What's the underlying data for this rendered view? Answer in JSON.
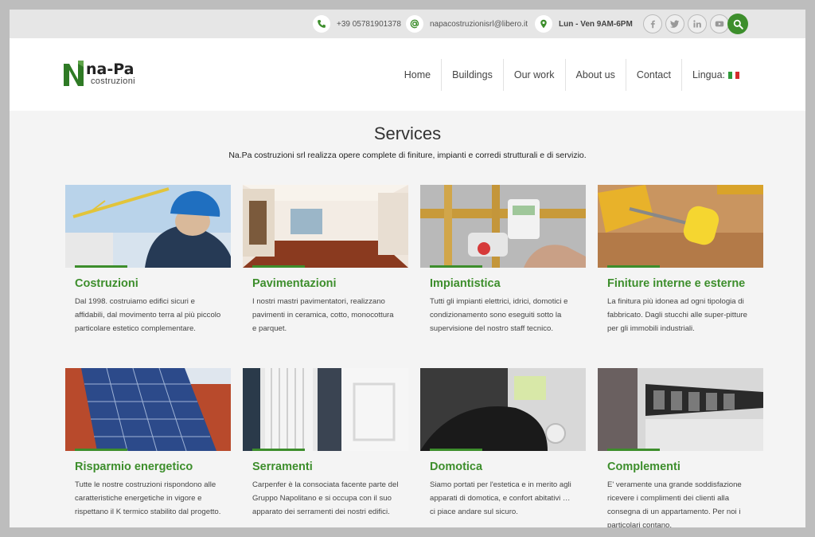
{
  "topbar": {
    "phone": "+39 05781901378",
    "email": "napacostruzionisrl@libero.it",
    "hours": "Lun - Ven 9AM-6PM",
    "social": [
      "facebook-icon",
      "twitter-icon",
      "linkedin-icon",
      "youtube-icon"
    ]
  },
  "header": {
    "logo_main": "na-Pa",
    "logo_sub": "costruzioni",
    "nav": [
      "Home",
      "Buildings",
      "Our work",
      "About us",
      "Contact",
      "Lingua:"
    ]
  },
  "services": {
    "title": "Services",
    "subtitle": "Na.Pa costruzioni srl realizza opere complete di finiture, impianti e corredi strutturali e di servizio.",
    "cards": [
      {
        "title": "Costruzioni",
        "text": "Dal 1998. costruiamo edifici sicuri e affidabili, dal movimento terra al più piccolo particolare estetico complementare."
      },
      {
        "title": "Pavimentazioni",
        "text": "I nostri mastri pavimentatori, realizzano pavimenti in ceramica, cotto, monocottura e parquet."
      },
      {
        "title": "Impiantistica",
        "text": "Tutti gli impianti elettrici, idrici, domotici e condizionamento sono eseguiti sotto la supervisione del nostro staff tecnico."
      },
      {
        "title": "Finiture interne e esterne",
        "text": "La finitura più idonea ad ogni tipologia di fabbricato. Dagli stucchi alle super-pitture per gli immobili industriali."
      },
      {
        "title": "Risparmio energetico",
        "text": "Tutte le nostre costruzioni rispondono alle caratteristiche energetiche in vigore e rispettano il K termico stabilito dal progetto."
      },
      {
        "title": "Serramenti",
        "text": "Carpenfer è la consociata facente parte del Gruppo Napolitano e si occupa con il suo apparato dei serramenti dei nostri edifici."
      },
      {
        "title": "Domotica",
        "text": "Siamo portati per l'estetica e in merito agli apparati di domotica, e confort abitativi … ci piace andare sul sicuro."
      },
      {
        "title": "Complementi",
        "text": "E' veramente una grande soddisfazione ricevere i complimenti dei clienti alla consegna di un appartamento. Per noi i particolari contano."
      }
    ]
  },
  "colors": {
    "accent": "#3d8e2c",
    "topbar": "#e6e6e6"
  }
}
